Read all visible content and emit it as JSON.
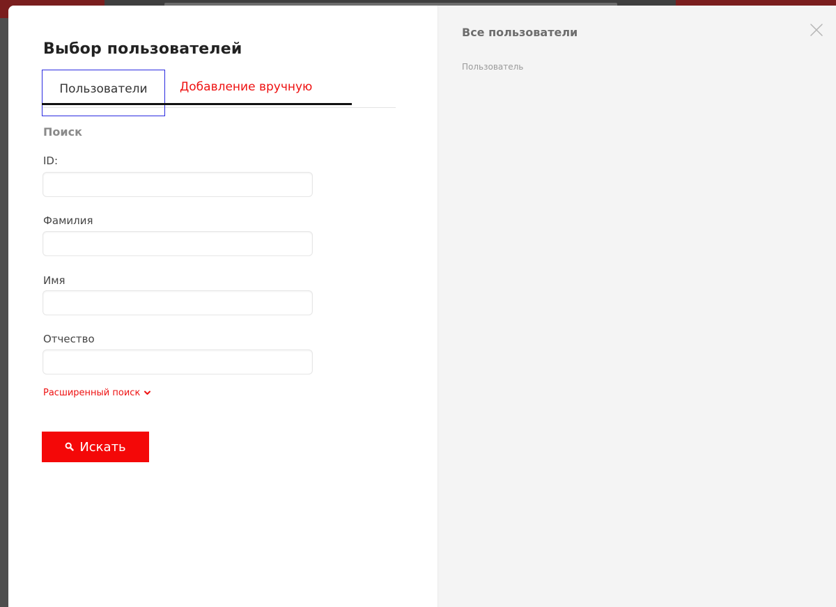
{
  "modal": {
    "title": "Выбор пользователей",
    "tabs": [
      {
        "label": "Пользователи",
        "active": true
      },
      {
        "label": "Добавление вручную",
        "active": false
      }
    ]
  },
  "search": {
    "section_title": "Поиск",
    "fields": [
      {
        "label": "ID:",
        "value": "",
        "placeholder": ""
      },
      {
        "label": "Фамилия",
        "value": "",
        "placeholder": ""
      },
      {
        "label": "Имя",
        "value": "",
        "placeholder": ""
      },
      {
        "label": "Отчество",
        "value": "",
        "placeholder": ""
      }
    ],
    "advanced_link": "Расширенный поиск",
    "submit_label": "Искать"
  },
  "results": {
    "title": "Все пользователи",
    "column_header": "Пользователь"
  },
  "icons": {
    "search": "search-icon",
    "chevron": "chevron-down-icon",
    "close": "close-icon"
  },
  "colors": {
    "accent": "#f40808",
    "link": "#ee1111",
    "focus_outline": "#2a2ae0"
  }
}
